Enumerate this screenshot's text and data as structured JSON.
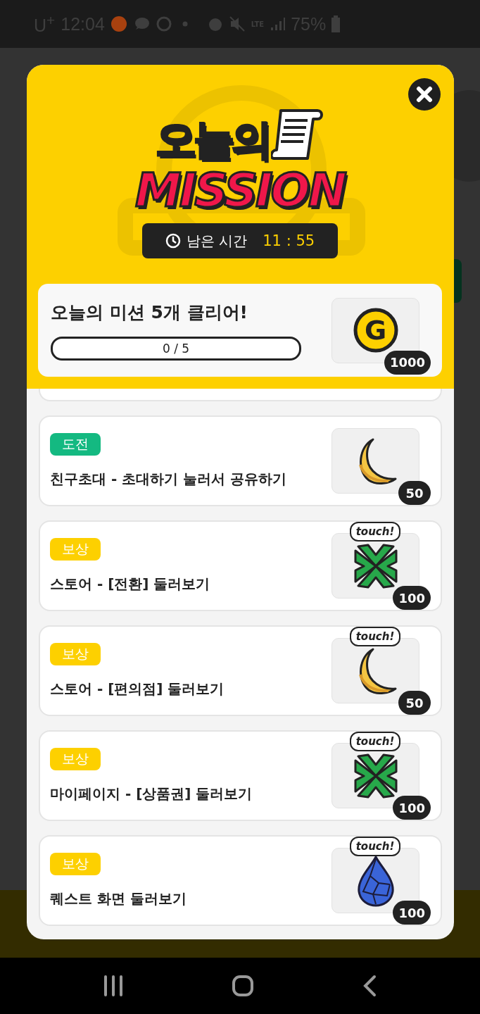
{
  "status_bar": {
    "carrier": "U$^{+}$",
    "time": "12:04",
    "network": "LTE",
    "battery": "75%"
  },
  "mission_popup": {
    "title_top": "오늘의",
    "title_bottom": "MISSION",
    "timer": {
      "label": "남은 시간",
      "value": "11 : 55"
    },
    "summary": {
      "title": "오늘의 미션 5개 클리어!",
      "progress": {
        "text": "0 / 5",
        "level": 0
      },
      "reward": {
        "kind": "coin",
        "symbol": "G",
        "amount": "1000"
      }
    },
    "missions": [
      {
        "tag": {
          "text": "도전",
          "color": "#14b981"
        },
        "title": "친구초대 - 초대하기 눌러서 공유하기",
        "reward": {
          "kind": "moon",
          "amount": "50"
        }
      },
      {
        "tag": {
          "text": "보상",
          "color": "#fdd000"
        },
        "title": "스토어 - [전환] 둘러보기",
        "reward": {
          "kind": "clover",
          "amount": "100",
          "touch": "touch!"
        }
      },
      {
        "tag": {
          "text": "보상",
          "color": "#fdd000"
        },
        "title": "스토어 - [편의점] 둘러보기",
        "reward": {
          "kind": "moon",
          "amount": "50",
          "touch": "touch!"
        }
      },
      {
        "tag": {
          "text": "보상",
          "color": "#fdd000"
        },
        "title": "마이페이지 - [상품권] 둘러보기",
        "reward": {
          "kind": "clover",
          "amount": "100",
          "touch": "touch!"
        }
      },
      {
        "tag": {
          "text": "보상",
          "color": "#fdd000"
        },
        "title": "퀘스트 화면 둘러보기",
        "reward": {
          "kind": "gem",
          "amount": "100",
          "touch": "touch!"
        }
      }
    ]
  }
}
